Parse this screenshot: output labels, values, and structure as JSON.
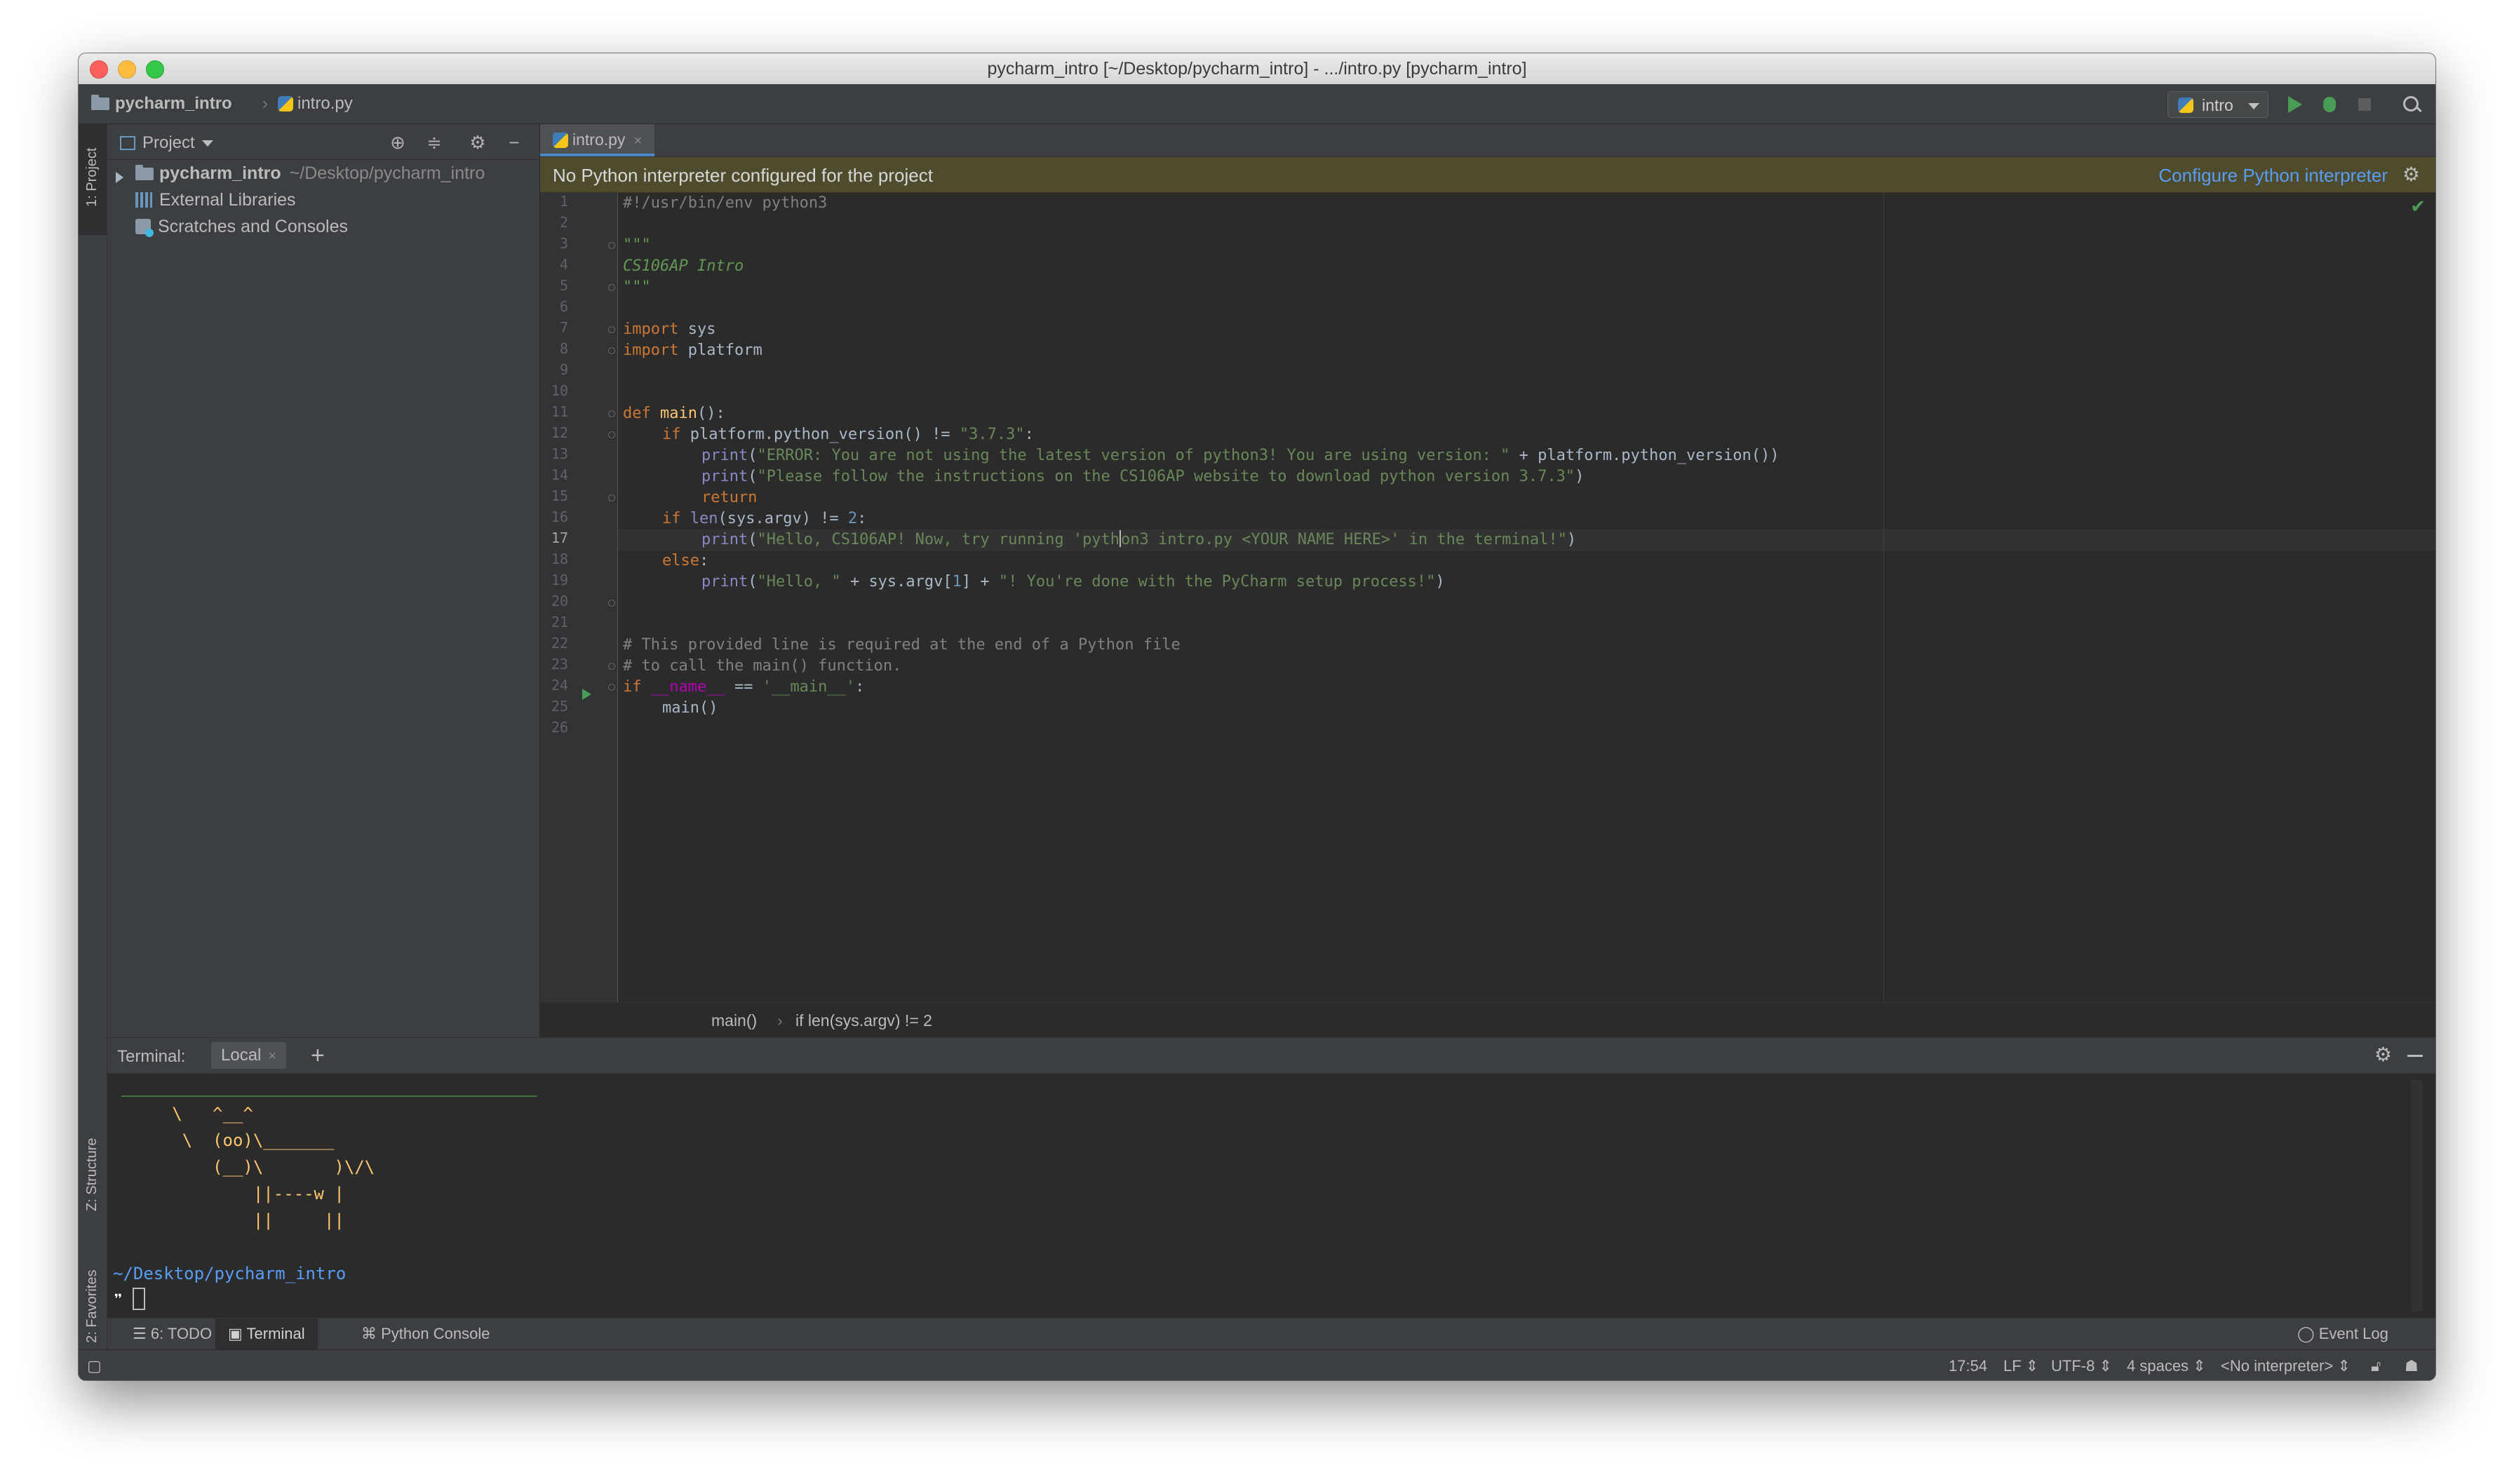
{
  "window": {
    "title": "pycharm_intro [~/Desktop/pycharm_intro] - .../intro.py [pycharm_intro]"
  },
  "navbar": {
    "project_crumb": "pycharm_intro",
    "file_crumb": "intro.py",
    "run_config": "intro"
  },
  "left_strip": {
    "project_tab": "1: Project",
    "structure_tab": "Z: Structure",
    "favorites_tab": "2: Favorites"
  },
  "project_panel": {
    "title": "Project",
    "tree": [
      {
        "label": "pycharm_intro",
        "path": "~/Desktop/pycharm_intro"
      },
      {
        "label": "External Libraries"
      },
      {
        "label": "Scratches and Consoles"
      }
    ]
  },
  "editor": {
    "tab_label": "intro.py",
    "banner_text": "No Python interpreter configured for the project",
    "banner_link": "Configure Python interpreter",
    "line_numbers": [
      "1",
      "2",
      "3",
      "4",
      "5",
      "6",
      "7",
      "8",
      "9",
      "10",
      "11",
      "12",
      "13",
      "14",
      "15",
      "16",
      "17",
      "18",
      "19",
      "20",
      "21",
      "22",
      "23",
      "24",
      "25",
      "26"
    ],
    "code": {
      "l1": "#!/usr/bin/env python3",
      "l3": "\"\"\"",
      "l4": "CS106AP Intro",
      "l5": "\"\"\"",
      "l7_kw": "import",
      "l7_mod": " sys",
      "l8_kw": "import",
      "l8_mod": " platform",
      "l11_kw": "def ",
      "l11_fn": "main",
      "l11_rest": "():",
      "l12_kw": "if",
      "l12_rest": " platform.python_version() != ",
      "l12_str": "\"3.7.3\"",
      "l12_end": ":",
      "l13_bi": "print",
      "l13_open": "(",
      "l13_str": "\"ERROR: You are not using the latest version of python3! You are using version: \"",
      "l13_rest": " + platform.python_version())",
      "l14_bi": "print",
      "l14_open": "(",
      "l14_str": "\"Please follow the instructions on the CS106AP website to download python version 3.7.3\"",
      "l14_end": ")",
      "l15_kw": "return",
      "l16_kw": "if",
      "l16_bi": " len",
      "l16_rest": "(sys.argv) != ",
      "l16_num": "2",
      "l16_end": ":",
      "l17_bi": "print",
      "l17_open": "(",
      "l17_str_a": "\"Hello, CS106AP! Now, try running 'pyth",
      "l17_str_b": "on3 intro.py <YOUR NAME HERE>' in the terminal!\"",
      "l17_end": ")",
      "l18_kw": "else",
      "l18_end": ":",
      "l19_bi": "print",
      "l19_open": "(",
      "l19_str1": "\"Hello, \"",
      "l19_mid": " + sys.argv[",
      "l19_num": "1",
      "l19_mid2": "] + ",
      "l19_str2": "\"! You're done with the PyCharm setup process!\"",
      "l19_end": ")",
      "l22": "# This provided line is required at the end of a Python file",
      "l23": "# to call the main() function.",
      "l24_kw": "if",
      "l24_sp": " __name__",
      "l24_op": " == ",
      "l24_str": "'__main__'",
      "l24_end": ":",
      "l25": "main()"
    },
    "breadcrumb": [
      "main()",
      "if len(sys.argv) != 2"
    ]
  },
  "terminal": {
    "label": "Terminal:",
    "tab": "Local",
    "lines": [
      "_________________________________________",
      "     \\   ^__^",
      "      \\  (oo)\\_______",
      "         (__)\\       )\\/\\",
      "             ||----w |",
      "             ||     ||"
    ],
    "prompt_path": "~/Desktop/pycharm_intro",
    "prompt_symbol": "❞"
  },
  "bottom_tabs": {
    "todo": "6: TODO",
    "terminal": "Terminal",
    "python_console": "Python Console",
    "event_log": "Event Log"
  },
  "statusbar": {
    "position": "17:54",
    "line_sep": "LF",
    "encoding": "UTF-8",
    "indent": "4 spaces",
    "interpreter": "<No interpreter>"
  },
  "colors": {
    "editor_bg": "#2b2b2b",
    "panel_bg": "#3c3f41",
    "keyword": "#cc7832",
    "string": "#6a8759",
    "banner_bg": "#4f4b2d",
    "link": "#589df6"
  }
}
